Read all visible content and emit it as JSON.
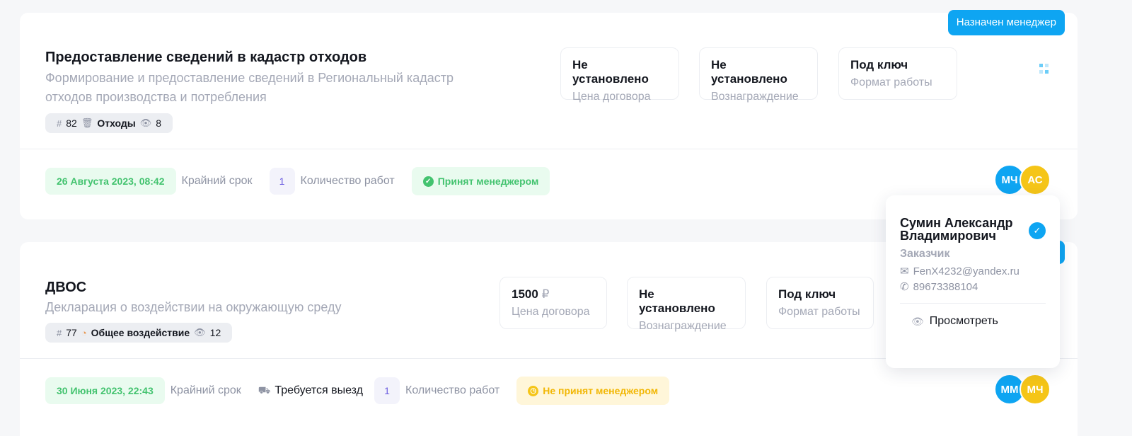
{
  "cards": [
    {
      "badge": "Назначен менеджер",
      "title": "Предоставление сведений в кадастр отходов",
      "description_line1": "Формирование и предоставление сведений в Региональный кадастр",
      "description_line2": "отходов производства и потребления",
      "chips": {
        "id": "82",
        "category": "Отходы",
        "views": "8",
        "category_icon": "trash-icon"
      },
      "stats": [
        {
          "value": "Не установлено",
          "label": "Цена договора"
        },
        {
          "value": "Не установлено",
          "label": "Вознаграждение"
        },
        {
          "value": "Под ключ",
          "label": "Формат работы"
        }
      ],
      "deadline": "26 Августа 2023, 08:42",
      "deadline_label": "Крайний срок",
      "work_count": "1",
      "work_count_label": "Количество работ",
      "status": "Принят менеджером",
      "avatars": [
        "МЧ",
        "АС"
      ]
    },
    {
      "title": "ДВОС",
      "description_line1": "Декларация о воздействии на окружающую среду",
      "chips": {
        "id": "77",
        "category": "Общее воздействие",
        "views": "12",
        "category_icon": "impact-icon"
      },
      "stats": [
        {
          "value": "1500",
          "currency": "₽",
          "label": "Цена договора"
        },
        {
          "value": "Не установлено",
          "label": "Вознаграждение"
        },
        {
          "value": "Под ключ",
          "label": "Формат работы"
        }
      ],
      "deadline": "30 Июня 2023, 22:43",
      "deadline_label": "Крайний срок",
      "visit": "Требуется выезд",
      "work_count": "1",
      "work_count_label": "Количество работ",
      "status": "Не принят менеджером",
      "avatars": [
        "ММ",
        "МЧ"
      ]
    }
  ],
  "popup": {
    "name": "Сумин Александр Владимирович",
    "role": "Заказчик",
    "email": "FenX4232@yandex.ru",
    "phone": "89673388104",
    "view_label": "Просмотреть"
  },
  "colors": {
    "accent": "#0ea5f2",
    "success": "#43c36f",
    "warning": "#f5c518",
    "muted": "#a4a8b6"
  }
}
